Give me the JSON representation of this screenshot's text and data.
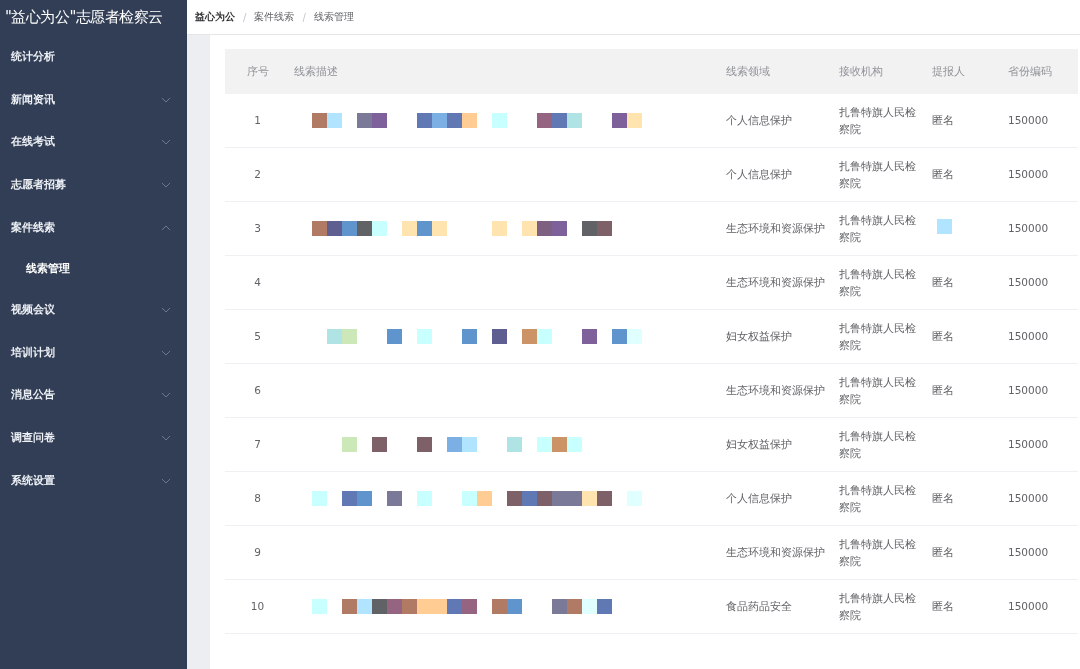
{
  "app_title": "\"益心为公\"志愿者检察云",
  "sidebar": {
    "items": [
      {
        "label": "统计分析",
        "kind": "link"
      },
      {
        "label": "新闻资讯",
        "kind": "submenu",
        "expanded": false
      },
      {
        "label": "在线考试",
        "kind": "submenu",
        "expanded": false
      },
      {
        "label": "志愿者招募",
        "kind": "submenu",
        "expanded": false
      },
      {
        "label": "案件线索",
        "kind": "submenu",
        "expanded": true,
        "children": [
          {
            "label": "线索管理",
            "selected": true
          }
        ]
      },
      {
        "label": "视频会议",
        "kind": "submenu",
        "expanded": false
      },
      {
        "label": "培训计划",
        "kind": "submenu",
        "expanded": false
      },
      {
        "label": "消息公告",
        "kind": "submenu",
        "expanded": false
      },
      {
        "label": "调查问卷",
        "kind": "submenu",
        "expanded": false
      },
      {
        "label": "系统设置",
        "kind": "submenu",
        "expanded": false
      }
    ]
  },
  "breadcrumb": [
    "益心为公",
    "案件线索",
    "线索管理"
  ],
  "breadcrumb_separator": "/",
  "table": {
    "columns": [
      "序号",
      "线索描述",
      "线索领域",
      "接收机构",
      "提报人",
      "省份编码"
    ],
    "rows": [
      {
        "index": "1",
        "description_redacted": true,
        "domain": "个人信息保护",
        "agency": "扎鲁特旗人民检察院",
        "reporter": "匿名",
        "reporter_redacted": false,
        "province_code": "150000"
      },
      {
        "index": "2",
        "description_redacted": false,
        "domain": "个人信息保护",
        "agency": "扎鲁特旗人民检察院",
        "reporter": "匿名",
        "reporter_redacted": false,
        "province_code": "150000"
      },
      {
        "index": "3",
        "description_redacted": true,
        "domain": "生态环境和资源保护",
        "agency": "扎鲁特旗人民检察院",
        "reporter_redacted": true,
        "province_code": "150000"
      },
      {
        "index": "4",
        "description_redacted": false,
        "domain": "生态环境和资源保护",
        "agency": "扎鲁特旗人民检察院",
        "reporter": "匿名",
        "reporter_redacted": false,
        "province_code": "150000"
      },
      {
        "index": "5",
        "description_redacted": true,
        "domain": "妇女权益保护",
        "agency": "扎鲁特旗人民检察院",
        "reporter": "匿名",
        "reporter_redacted": false,
        "province_code": "150000"
      },
      {
        "index": "6",
        "description_redacted": false,
        "domain": "生态环境和资源保护",
        "agency": "扎鲁特旗人民检察院",
        "reporter": "匿名",
        "reporter_redacted": false,
        "province_code": "150000"
      },
      {
        "index": "7",
        "description_redacted": true,
        "domain": "妇女权益保护",
        "agency": "扎鲁特旗人民检察院",
        "reporter_redacted": false,
        "province_code": "150000"
      },
      {
        "index": "8",
        "description_redacted": true,
        "domain": "个人信息保护",
        "agency": "扎鲁特旗人民检察院",
        "reporter": "匿名",
        "reporter_redacted": false,
        "province_code": "150000"
      },
      {
        "index": "9",
        "description_redacted": false,
        "domain": "生态环境和资源保护",
        "agency": "扎鲁特旗人民检察院",
        "reporter": "匿名",
        "reporter_redacted": false,
        "province_code": "150000"
      },
      {
        "index": "10",
        "description_redacted": true,
        "domain": "食品药品安全",
        "agency": "扎鲁特旗人民检察院",
        "reporter": "匿名",
        "reporter_redacted": false,
        "province_code": "150000"
      }
    ]
  }
}
